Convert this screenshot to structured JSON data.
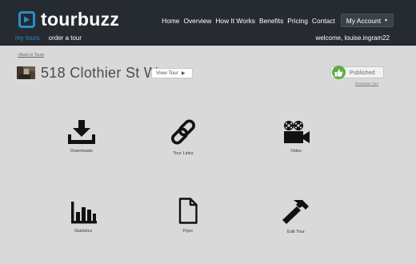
{
  "brand": {
    "name": "tourbuzz",
    "accent": "#2b8ccc"
  },
  "nav": {
    "items": [
      "Home",
      "Overview",
      "How It Works",
      "Benefits",
      "Pricing",
      "Contact"
    ],
    "account": "My Account"
  },
  "subnav": {
    "items": [
      "my tours",
      "order a tour"
    ],
    "welcome": "welcome, louise.ingram22"
  },
  "tour": {
    "back_link": "«Back to Tours",
    "address": "518 Clothier St W",
    "view_tour": "View Tour",
    "status": "Published",
    "deactivate": "Deactivate Tour",
    "status_color": "#5fae44"
  },
  "tiles": [
    {
      "label": "Downloads",
      "icon": "download-icon"
    },
    {
      "label": "Tour Links",
      "icon": "link-icon"
    },
    {
      "label": "Video",
      "icon": "video-camera-icon"
    },
    {
      "label": "Statistics",
      "icon": "bar-chart-icon"
    },
    {
      "label": "Flyer",
      "icon": "document-icon"
    },
    {
      "label": "Edit Tour",
      "icon": "hammer-icon"
    }
  ]
}
